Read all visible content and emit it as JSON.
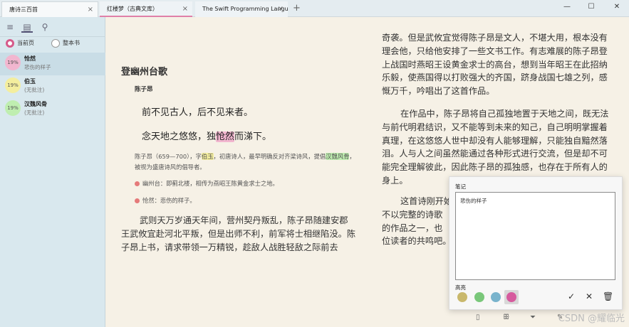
{
  "tabs": [
    {
      "label": "唐诗三百首",
      "close": "×"
    },
    {
      "label": "红楼梦（古典文库）",
      "close": "×"
    },
    {
      "label": "The Swift Programming Language (5",
      "close": "×"
    }
  ],
  "tab_add": "+",
  "window_controls": {
    "minimize": "—",
    "maximize": "☐",
    "close": "✕"
  },
  "sidebar": {
    "scope": {
      "current_page": "当前页",
      "whole_book": "整本书",
      "selected": "当前页"
    },
    "notes": [
      {
        "pct": "19%",
        "word": "怆然",
        "note": "悲伤的样子",
        "color": "#f2b6cf"
      },
      {
        "pct": "19%",
        "word": "伯玉",
        "note": "(无批注)",
        "color": "#f4ee9e"
      },
      {
        "pct": "19%",
        "word": "汉魏风骨",
        "note": "(无批注)",
        "color": "#bfeeb0"
      }
    ]
  },
  "page1": {
    "title": "登幽州台歌",
    "author": "陈子昂",
    "verse1": "前不见古人，后不见来者。",
    "verse2_a": "念天地之悠悠，独",
    "verse2_hl": "怆然",
    "verse2_b": "而涕下。",
    "bio_a": "陈子昂（659—700），字",
    "bio_hl1": "伯玉",
    "bio_b": "，初唐诗人，最早明确反对齐梁诗风，提倡",
    "bio_hl2": "汉魏风骨",
    "bio_c": "，被视为盛唐诗风的倡导者。",
    "fn1": "幽州台：即蓟北楼，相传为燕昭王陈黄金求士之地。",
    "fn2": "怆然：悲伤的样子。",
    "body": "武则天万岁通天年间，营州契丹叛乱，陈子昂随建安郡王武攸宜赴河北平叛，但是出师不利，前军将士相继陷没。陈子昂上书，请求带领一万精锐，趁敌人战胜轻敌之际前去"
  },
  "page2": {
    "para1": "奇袭。但是武攸宜觉得陈子昂是文人，不堪大用，根本没有理会他，只给他安排了一些文书工作。有志难展的陈子昂登上战国时燕昭王设黄金求士的高台，想到当年昭王在此招纳乐毅，使燕国得以打败强大的齐国，跻身战国七雄之列，感慨万千，吟唱出了这首作品。",
    "para2": "在作品中，陈子昂将自己孤独地置于天地之间，既无法与前代明君结识，又不能等到未来的知己，自己明明掌握着真理，在这悠悠人世中却没有人能够理解，只能独自黯然落泪。人与人之间虽然能通过各种形式进行交流，但是却不可能完全理解彼此，因此陈子昂的孤独感，也存在于所有人的身上。",
    "para3_l1": "这首诗刚开始",
    "para3_l2": "不以完整的诗歌",
    "para3_l3": "的作品之一，也",
    "para3_l4": "位读者的共鸣吧。"
  },
  "note_panel": {
    "label": "笔记",
    "text": "悲伤的样子",
    "highlight_label": "高亮",
    "colors": [
      "#c9b86c",
      "#79c77a",
      "#79b3cc",
      "#d65b9e"
    ],
    "selected_color": "#d65b9e",
    "confirm": "✓",
    "cancel": "✕",
    "delete": "🗑"
  },
  "bottombar_icons": [
    "bookmark-icon",
    "tts-icon",
    "filter-icon",
    "highlight-pen-icon"
  ],
  "watermark": "CSDN @耀临光"
}
